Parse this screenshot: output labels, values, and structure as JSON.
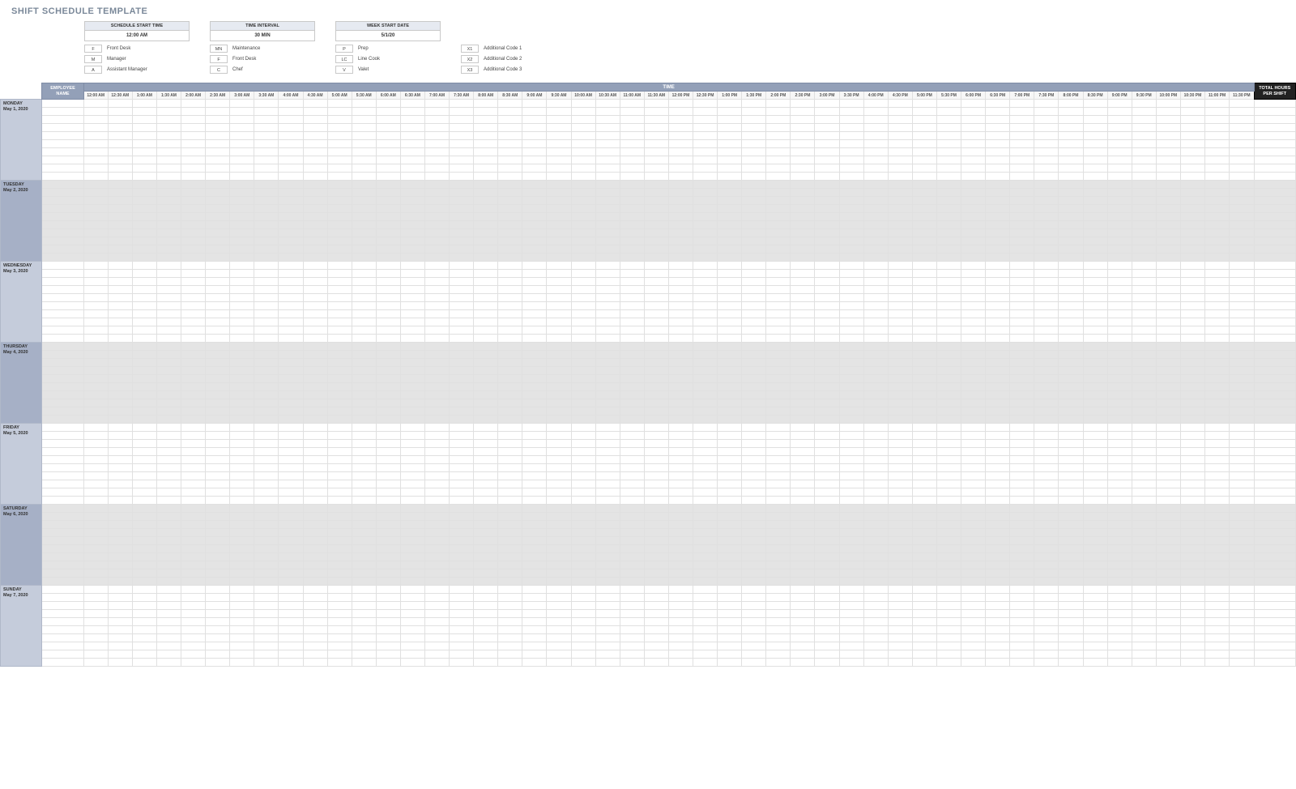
{
  "title": "SHIFT SCHEDULE TEMPLATE",
  "settings": [
    {
      "label": "SCHEDULE START TIME",
      "value": "12:00 AM"
    },
    {
      "label": "TIME INTERVAL",
      "value": "30 MIN"
    },
    {
      "label": "WEEK START DATE",
      "value": "5/1/20"
    }
  ],
  "legend": [
    [
      {
        "code": "F",
        "label": "Front Desk"
      },
      {
        "code": "M",
        "label": "Manager"
      },
      {
        "code": "A",
        "label": "Assistant Manager"
      }
    ],
    [
      {
        "code": "MN",
        "label": "Maintenance"
      },
      {
        "code": "F",
        "label": "Front Desk"
      },
      {
        "code": "C",
        "label": "Chef"
      }
    ],
    [
      {
        "code": "P",
        "label": "Prep"
      },
      {
        "code": "LC",
        "label": "Line Cook"
      },
      {
        "code": "V",
        "label": "Valet"
      }
    ],
    [
      {
        "code": "X1",
        "label": "Additional Code 1"
      },
      {
        "code": "X2",
        "label": "Additional Code 2"
      },
      {
        "code": "X3",
        "label": "Additional Code 3"
      }
    ]
  ],
  "headers": {
    "employee_name": "EMPLOYEE NAME",
    "time": "TIME",
    "total": "TOTAL HOURS PER SHIFT"
  },
  "time_slots": [
    "12:00 AM",
    "12:30 AM",
    "1:00 AM",
    "1:30 AM",
    "2:00 AM",
    "2:30 AM",
    "3:00 AM",
    "3:30 AM",
    "4:00 AM",
    "4:30 AM",
    "5:00 AM",
    "5:30 AM",
    "6:00 AM",
    "6:30 AM",
    "7:00 AM",
    "7:30 AM",
    "8:00 AM",
    "8:30 AM",
    "9:00 AM",
    "9:30 AM",
    "10:00 AM",
    "10:30 AM",
    "11:00 AM",
    "11:30 AM",
    "12:00 PM",
    "12:30 PM",
    "1:00 PM",
    "1:30 PM",
    "2:00 PM",
    "2:30 PM",
    "3:00 PM",
    "3:30 PM",
    "4:00 PM",
    "4:30 PM",
    "5:00 PM",
    "5:30 PM",
    "6:00 PM",
    "6:30 PM",
    "7:00 PM",
    "7:30 PM",
    "8:00 PM",
    "8:30 PM",
    "9:00 PM",
    "9:30 PM",
    "10:00 PM",
    "10:30 PM",
    "11:00 PM",
    "11:30 PM"
  ],
  "days": [
    {
      "name": "MONDAY",
      "date": "May 1, 2020",
      "shade": false
    },
    {
      "name": "TUESDAY",
      "date": "May 2, 2020",
      "shade": true
    },
    {
      "name": "WEDNESDAY",
      "date": "May 3, 2020",
      "shade": false
    },
    {
      "name": "THURSDAY",
      "date": "May 4, 2020",
      "shade": true
    },
    {
      "name": "FRIDAY",
      "date": "May 5, 2020",
      "shade": false
    },
    {
      "name": "SATURDAY",
      "date": "May 6, 2020",
      "shade": true
    },
    {
      "name": "SUNDAY",
      "date": "May 7, 2020",
      "shade": false
    }
  ],
  "rows_per_day": 10
}
